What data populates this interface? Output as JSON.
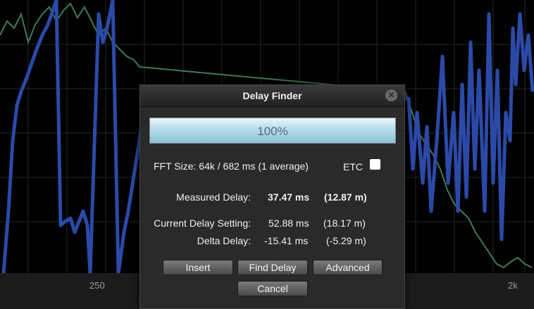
{
  "axis": {
    "left_label": "250",
    "right_label": "2k"
  },
  "dialog": {
    "title": "Delay Finder",
    "close_glyph": "✕",
    "progress": {
      "value": 1.0,
      "label": "100%"
    },
    "fft_size": "FFT Size: 64k / 682 ms (1 average)",
    "etc": {
      "label": "ETC",
      "checked": false
    },
    "measured": {
      "label": "Measured Delay:",
      "ms": "37.47 ms",
      "m": "(12.87 m)"
    },
    "current": {
      "label": "Current Delay Setting:",
      "ms": "52.88 ms",
      "m": "(18.17 m)"
    },
    "delta": {
      "label": "Delta Delay:",
      "ms": "-15.41 ms",
      "m": "(-5.29 m)"
    },
    "buttons": {
      "insert": "Insert",
      "find_delay": "Find Delay",
      "advanced": "Advanced",
      "cancel": "Cancel"
    }
  },
  "colors": {
    "blue_trace": "#2b4aa8",
    "green_trace": "#3f7a55",
    "grid": "#2a2a2a",
    "progress_fill": "#a8d4e4"
  }
}
